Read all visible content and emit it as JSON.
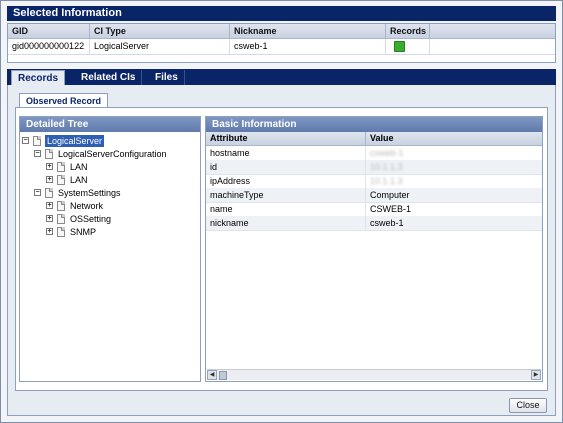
{
  "selected_info": {
    "title": "Selected Information",
    "columns": [
      "GID",
      "CI Type",
      "Nickname",
      "Records"
    ],
    "row": {
      "gid": "gid000000000122",
      "ci_type": "LogicalServer",
      "nickname": "csweb-1",
      "records_icon": "records-icon"
    }
  },
  "tabs": [
    "Records",
    "Related CIs",
    "Files"
  ],
  "active_tab": "Records",
  "subtab": "Observed Record",
  "tree": {
    "title": "Detailed Tree",
    "nodes": [
      {
        "label": "LogicalServer",
        "selected": true
      },
      {
        "label": "LogicalServerConfiguration"
      },
      {
        "label": "LAN"
      },
      {
        "label": "LAN"
      },
      {
        "label": "SystemSettings"
      },
      {
        "label": "Network"
      },
      {
        "label": "OSSetting"
      },
      {
        "label": "SNMP"
      }
    ]
  },
  "basic_info": {
    "title": "Basic Information",
    "columns": [
      "Attribute",
      "Value"
    ],
    "rows": [
      {
        "attr": "hostname",
        "value": "csweb-1",
        "obscured": true
      },
      {
        "attr": "id",
        "value": "10.1.1.3",
        "obscured": true
      },
      {
        "attr": "ipAddress",
        "value": "10.1.1.3",
        "obscured": true
      },
      {
        "attr": "machineType",
        "value": "Computer"
      },
      {
        "attr": "name",
        "value": "CSWEB-1"
      },
      {
        "attr": "nickname",
        "value": "csweb-1"
      }
    ]
  },
  "close_label": "Close",
  "colors": {
    "header_navy": "#0a2468",
    "panel_blue": "#6f88b8",
    "record_green": "#3aae2c"
  }
}
